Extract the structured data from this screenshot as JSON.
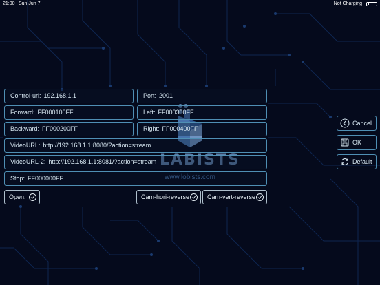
{
  "status_bar": {
    "time": "21:00",
    "date": "Sun Jun 7",
    "charging": "Not Charging"
  },
  "logo": {
    "text": "LABISTS",
    "url": "www.lobists.com"
  },
  "fields": {
    "control_url": {
      "label": "Control-url:",
      "value": "192.168.1.1"
    },
    "port": {
      "label": "Port:",
      "value": "2001"
    },
    "forward": {
      "label": "Forward:",
      "value": "FF000100FF"
    },
    "left": {
      "label": "Left:",
      "value": "FF000300FF"
    },
    "backward": {
      "label": "Backward:",
      "value": "FF000200FF"
    },
    "right": {
      "label": "Right:",
      "value": "FF000400FF"
    },
    "video_url": {
      "label": "VideoURL:",
      "value": "http://192.168.1.1:8080/?action=stream"
    },
    "video_url_2": {
      "label": "VideoURL-2:",
      "value": "http://192.168.1.1:8081/?action=stream"
    },
    "stop": {
      "label": "Stop:",
      "value": "FF000000FF"
    }
  },
  "toggles": {
    "open": "Open:",
    "cam_hori_reverse": "Cam-hori-reverse",
    "cam_vert_reverse": "Cam-vert-reverse"
  },
  "buttons": {
    "cancel": "Cancel",
    "ok": "OK",
    "default": "Default"
  },
  "icons": {
    "cancel": "chevron-left-circle-icon",
    "ok": "save-icon",
    "default": "refresh-icon",
    "toggle": "check-circle-icon"
  },
  "colors": {
    "background": "#050a1c",
    "field_border": "#4f8fb4",
    "circuit": "#1a3a6e"
  }
}
